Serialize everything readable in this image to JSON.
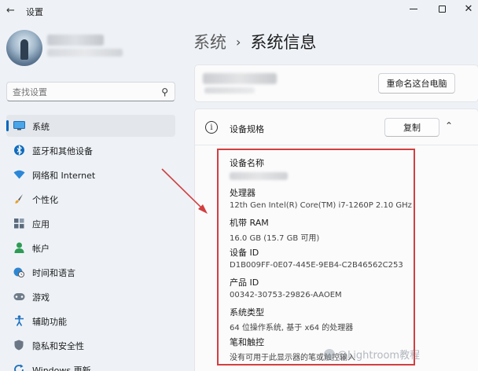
{
  "window": {
    "title": "设置",
    "back_icon": "arrow-left-icon",
    "minimize_icon": "minimize-icon",
    "maximize_icon": "maximize-icon",
    "close_icon": "close-icon"
  },
  "search": {
    "placeholder": "查找设置",
    "icon": "search-icon"
  },
  "sidebar": {
    "items": [
      {
        "label": "系统",
        "icon": "monitor-icon",
        "active": true
      },
      {
        "label": "蓝牙和其他设备",
        "icon": "bluetooth-icon"
      },
      {
        "label": "网络和 Internet",
        "icon": "wifi-icon"
      },
      {
        "label": "个性化",
        "icon": "brush-icon"
      },
      {
        "label": "应用",
        "icon": "apps-icon"
      },
      {
        "label": "帐户",
        "icon": "person-icon"
      },
      {
        "label": "时间和语言",
        "icon": "globe-clock-icon"
      },
      {
        "label": "游戏",
        "icon": "gamepad-icon"
      },
      {
        "label": "辅助功能",
        "icon": "accessibility-icon"
      },
      {
        "label": "隐私和安全性",
        "icon": "shield-icon"
      },
      {
        "label": "Windows 更新",
        "icon": "update-icon"
      }
    ]
  },
  "header": {
    "parent": "系统",
    "current": "系统信息"
  },
  "device": {
    "rename_label": "重命名这台电脑"
  },
  "specs": {
    "title": "设备规格",
    "copy_label": "复制",
    "info_icon": "info-icon",
    "collapse_icon": "chevron-up-icon",
    "rows": [
      {
        "label": "设备名称",
        "value": ""
      },
      {
        "label": "处理器",
        "value": "12th Gen Intel(R) Core(TM) i7-1260P   2.10 GHz"
      },
      {
        "label": "机带 RAM",
        "value": "16.0 GB (15.7 GB 可用)"
      },
      {
        "label": "设备 ID",
        "value": "D1B009FF-0E07-445E-9EB4-C2B46562C253"
      },
      {
        "label": "产品 ID",
        "value": "00342-30753-29826-AAOEM"
      },
      {
        "label": "系统类型",
        "value": "64 位操作系统, 基于 x64 的处理器"
      },
      {
        "label": "笔和触控",
        "value": "没有可用于此显示器的笔或触控输入"
      }
    ]
  },
  "annotation": {
    "color": "#d23f3f"
  },
  "watermark": {
    "text": "@Lightroom教程"
  },
  "colors": {
    "accent": "#0067c0",
    "background": "#eef2f7"
  }
}
